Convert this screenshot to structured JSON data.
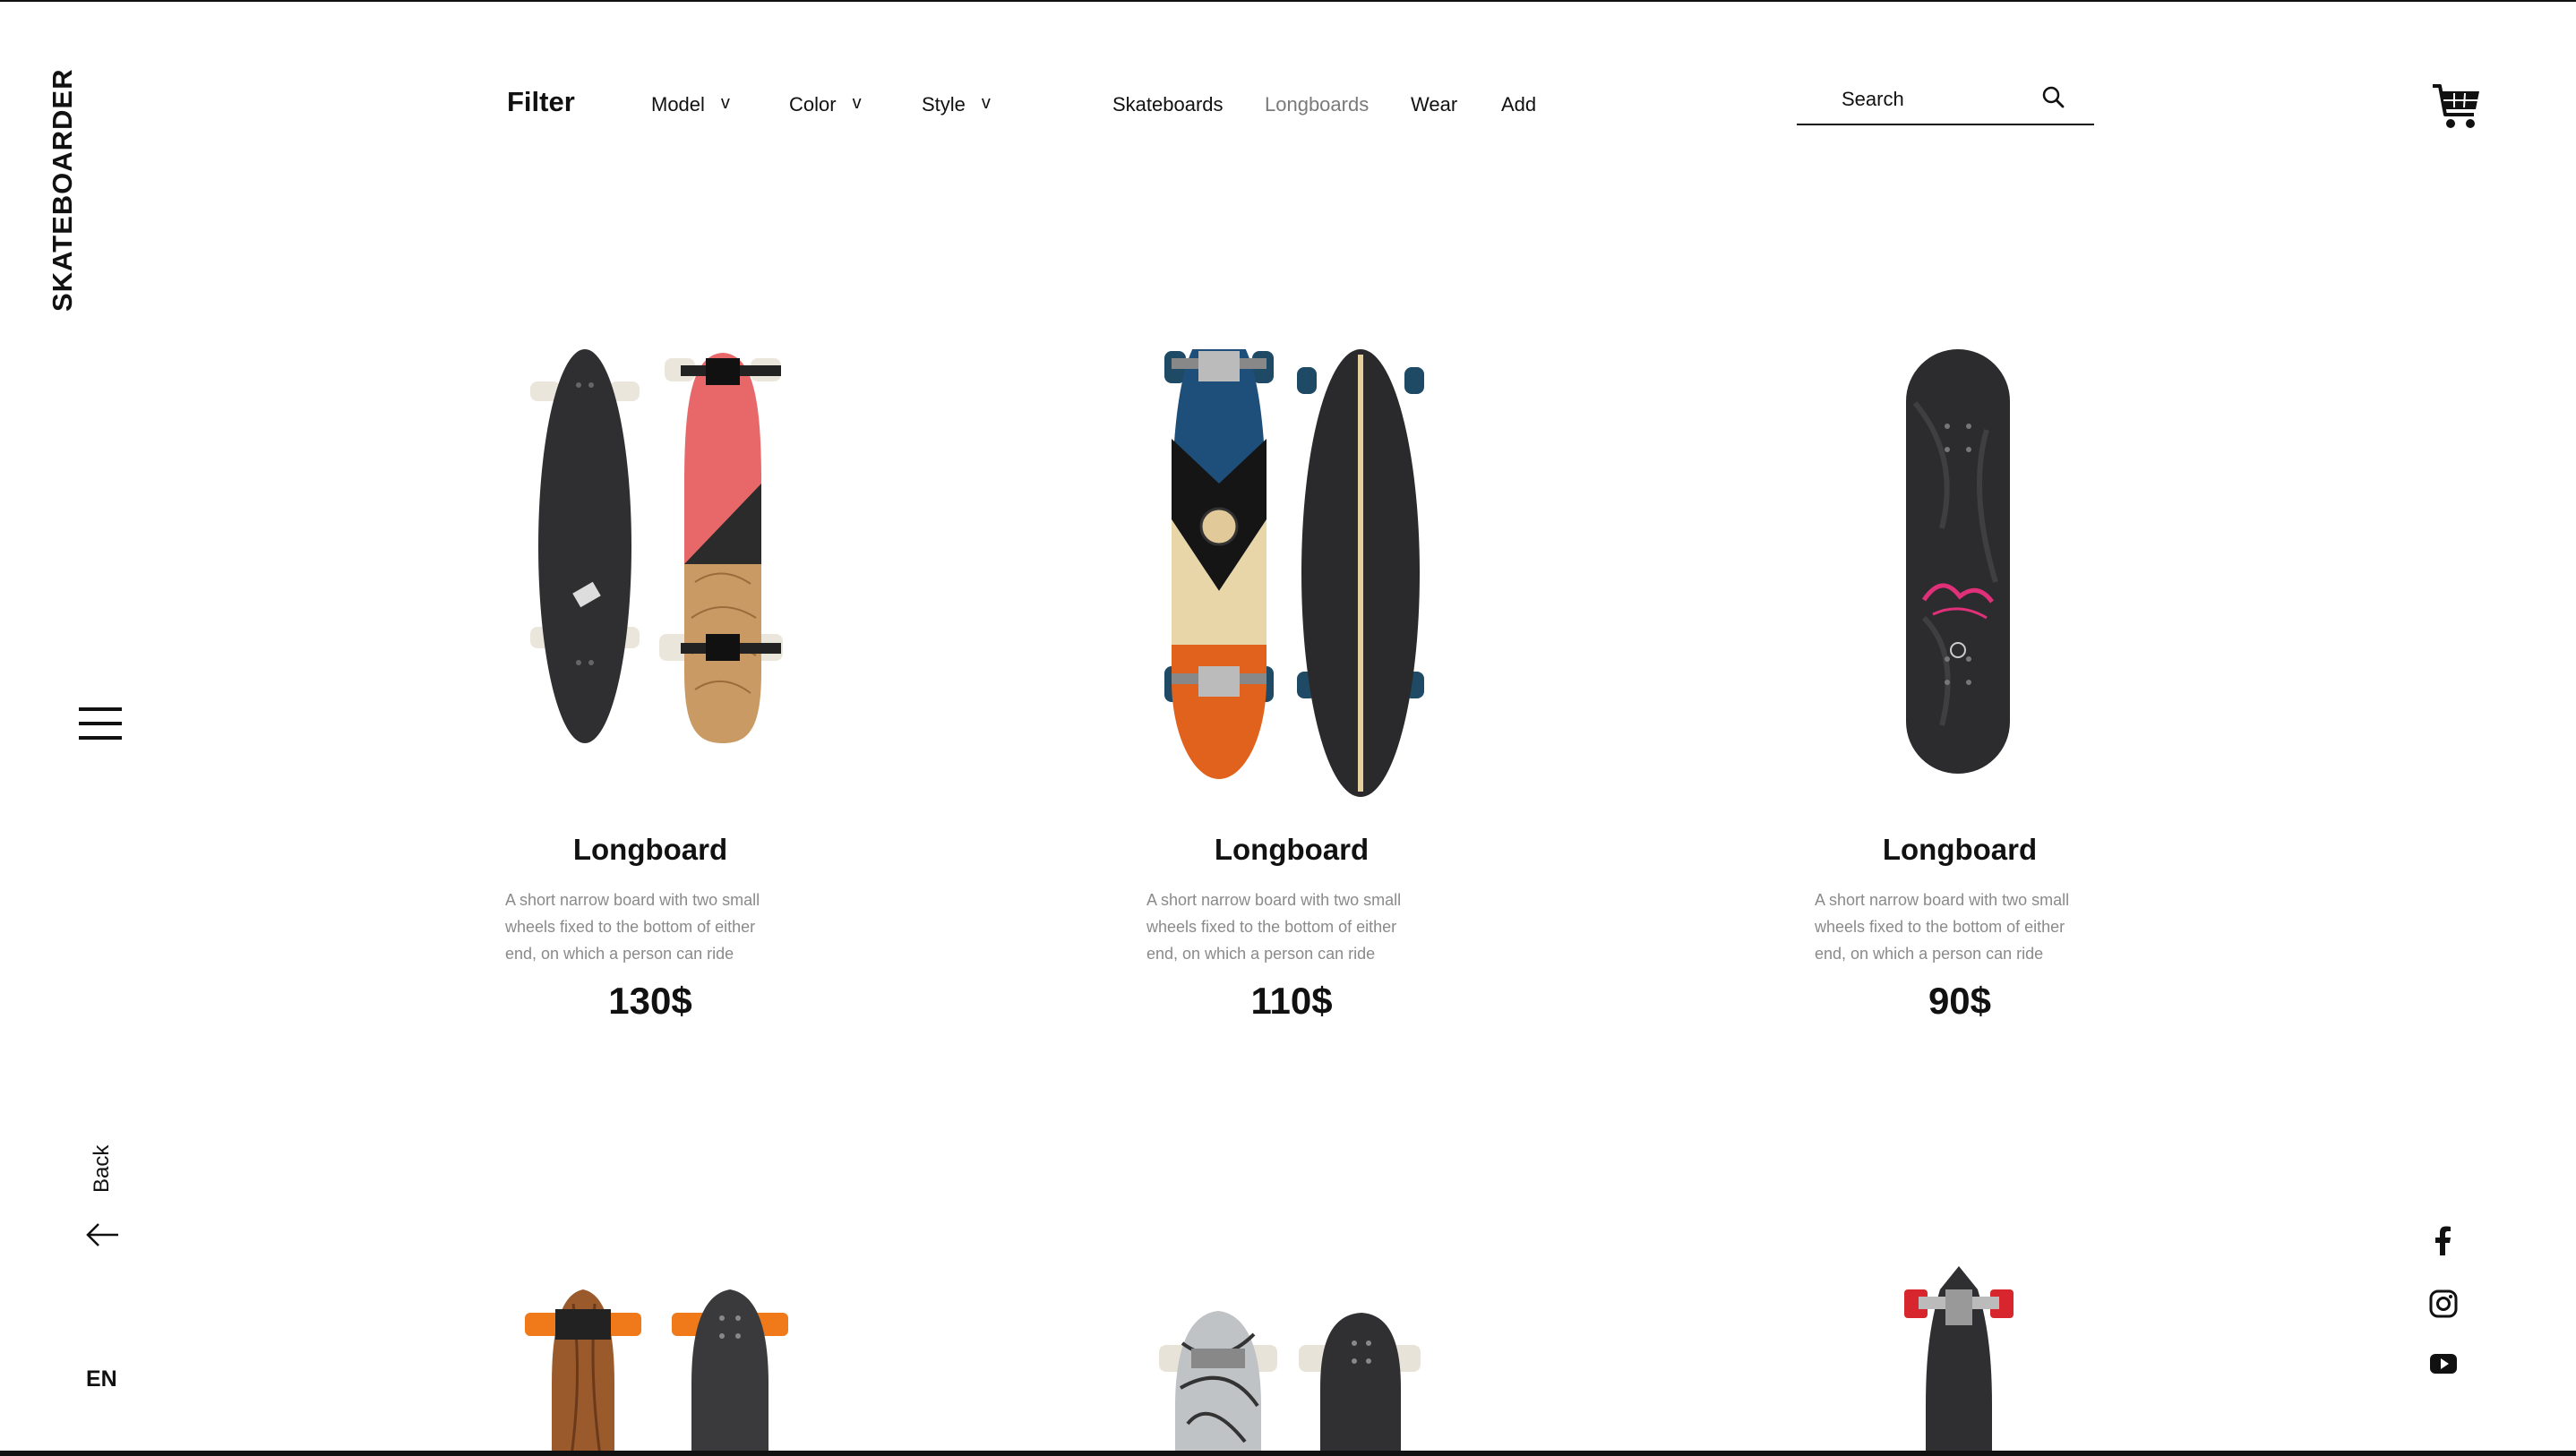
{
  "brand": "SKATEBOARDER",
  "filter": {
    "label": "Filter",
    "dropdowns": [
      {
        "label": "Model",
        "chevron": "v"
      },
      {
        "label": "Color",
        "chevron": "v"
      },
      {
        "label": "Style",
        "chevron": "v"
      }
    ]
  },
  "nav": {
    "items": [
      "Skateboards",
      "Longboards",
      "Wear",
      "Add"
    ],
    "active": "Longboards",
    "active_color": "#7a7a7a"
  },
  "search": {
    "placeholder": "Search"
  },
  "sidebar": {
    "back_label": "Back",
    "language": "EN"
  },
  "products": [
    {
      "title": "Longboard",
      "description": "A short narrow board with two small wheels fixed to the bottom of either end, on which a person can ride",
      "price": "130$"
    },
    {
      "title": "Longboard",
      "description": "A short narrow board with two small wheels fixed to the bottom of either end, on which a person can ride",
      "price": "110$"
    },
    {
      "title": "Longboard",
      "description": "A short narrow board with two small wheels fixed to the bottom of either end, on which a person can ride",
      "price": "90$"
    }
  ],
  "social": [
    "facebook-icon",
    "instagram-icon",
    "youtube-icon"
  ],
  "colors": {
    "text": "#111111",
    "muted": "#8a8a8a",
    "accent_pink": "#e8686a",
    "accent_blue": "#1e4f7a",
    "accent_orange": "#e0621c"
  }
}
